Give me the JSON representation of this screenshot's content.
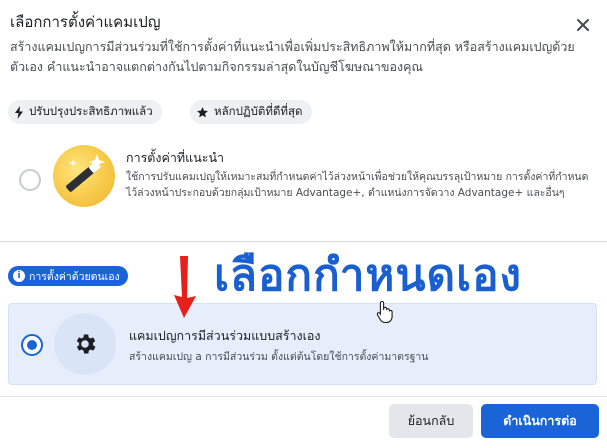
{
  "dialog": {
    "title": "เลือกการตั้งค่าแคมเปญ",
    "description": "สร้างแคมเปญการมีส่วนร่วมที่ใช้การตั้งค่าที่แนะนำเพื่อเพิ่มประสิทธิภาพให้มากที่สุด หรือสร้างแคมเปญด้วยตัวเอง คำแนะนำอาจแตกต่างกันไปตามกิจกรรมล่าสุดในบัญชีโฆษณาของคุณ",
    "close_icon": "close-icon"
  },
  "chips": [
    {
      "label": "ปรับปรุงประสิทธิภาพแล้ว",
      "icon": "lightning-icon"
    },
    {
      "label": "หลักปฏิบัติที่ดีที่สุด",
      "icon": "star-icon"
    }
  ],
  "recommended": {
    "title": "การตั้งค่าที่แนะนำ",
    "description": "ใช้การปรับแคมเปญให้เหมาะสมที่กำหนดค่าไว้ล่วงหน้าเพื่อช่วยให้คุณบรรลุเป้าหมาย การตั้งค่าที่กำหนดไว้ล่วงหน้าประกอบด้วยกลุ่มเป้าหมาย Advantage+, ตำแหน่งการจัดวาง Advantage+ และอื่นๆ",
    "selected": false,
    "icon": "magic-wand-icon"
  },
  "manual": {
    "badge": "การตั้งค่าด้วยตนเอง",
    "title": "แคมเปญการมีส่วนร่วมแบบสร้างเอง",
    "description": "สร้างแคมเปญ a การมีส่วนร่วม ตั้งแต่ต้นโดยใช้การตั้งค่ามาตรฐาน",
    "selected": true,
    "icon": "gear-icon"
  },
  "overlay_caption": "เลือกกำหนดเอง",
  "footer": {
    "back_label": "ย้อนกลับ",
    "next_label": "ดำเนินการต่อ"
  },
  "colors": {
    "accent": "#1b64d8",
    "selected_card_bg": "#e7eefb",
    "arrow": "#e8201b"
  }
}
